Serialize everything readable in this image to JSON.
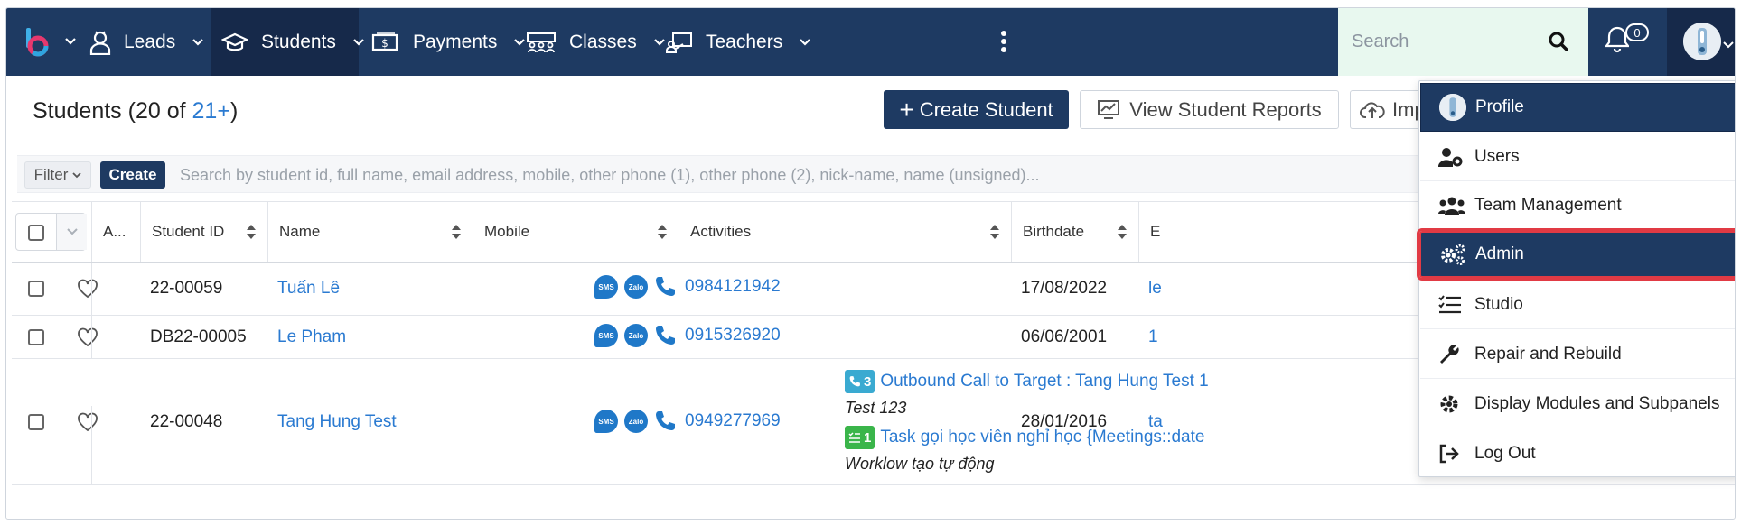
{
  "nav": {
    "items": [
      {
        "label": "Leads",
        "icon": "user-tie-icon"
      },
      {
        "label": "Students",
        "icon": "graduation-cap-icon",
        "active": true
      },
      {
        "label": "Payments",
        "icon": "money-bill-icon"
      },
      {
        "label": "Classes",
        "icon": "class-icon"
      },
      {
        "label": "Teachers",
        "icon": "chalkboard-teacher-icon"
      }
    ],
    "search_placeholder": "Search",
    "notification_count": "0"
  },
  "page": {
    "title_prefix": "Students (20 of ",
    "title_count": "21+",
    "title_suffix": ")",
    "create_student": "Create Student",
    "view_reports": "View Student Reports",
    "import": "Imp"
  },
  "filter": {
    "filter_label": "Filter",
    "create_label": "Create",
    "search_placeholder": "Search by student id, full name, email address, mobile, other phone (1), other phone (2), nick-name, name (unsigned)..."
  },
  "table": {
    "headers": {
      "assigned": "A...",
      "student_id": "Student ID",
      "name": "Name",
      "mobile": "Mobile",
      "activities": "Activities",
      "birthdate": "Birthdate",
      "extra": "E"
    },
    "rows": [
      {
        "student_id": "22-00059",
        "name": "Tuấn Lê",
        "mobile": "0984121942",
        "birthdate": "17/08/2022",
        "extra": "le"
      },
      {
        "student_id": "DB22-00005",
        "name": "Le Pham",
        "mobile": "0915326920",
        "birthdate": "06/06/2001",
        "extra": "1"
      },
      {
        "student_id": "22-00048",
        "name": "Tang Hung Test",
        "mobile": "0949277969",
        "birthdate": "28/01/2016",
        "extra": "ta",
        "activities": [
          {
            "badge": "3",
            "type": "call",
            "title": "Outbound Call to Target : Tang Hung Test 1",
            "desc": "Test 123"
          },
          {
            "badge": "1",
            "type": "task",
            "title": "Task gọi học viên nghỉ học {Meetings::date",
            "desc": "Worklow tạo tự động"
          }
        ]
      }
    ],
    "badges": {
      "sms": "SMS",
      "zalo": "Zalo"
    }
  },
  "user_menu": {
    "items": [
      {
        "label": "Profile",
        "icon": "avatar-icon"
      },
      {
        "label": "Users",
        "icon": "user-cog-icon"
      },
      {
        "label": "Team Management",
        "icon": "users-icon"
      },
      {
        "label": "Admin",
        "icon": "cogs-icon"
      },
      {
        "label": "Studio",
        "icon": "tasks-list-icon"
      },
      {
        "label": "Repair and Rebuild",
        "icon": "wrench-icon"
      },
      {
        "label": "Display Modules and Subpanels",
        "icon": "cog-icon"
      },
      {
        "label": "Log Out",
        "icon": "sign-out-icon"
      }
    ]
  },
  "colors": {
    "navbar": "#1e3a62",
    "accent_link": "#2a7ad1",
    "highlight_border": "#e13a44",
    "search_bg": "#e8f8ef"
  }
}
